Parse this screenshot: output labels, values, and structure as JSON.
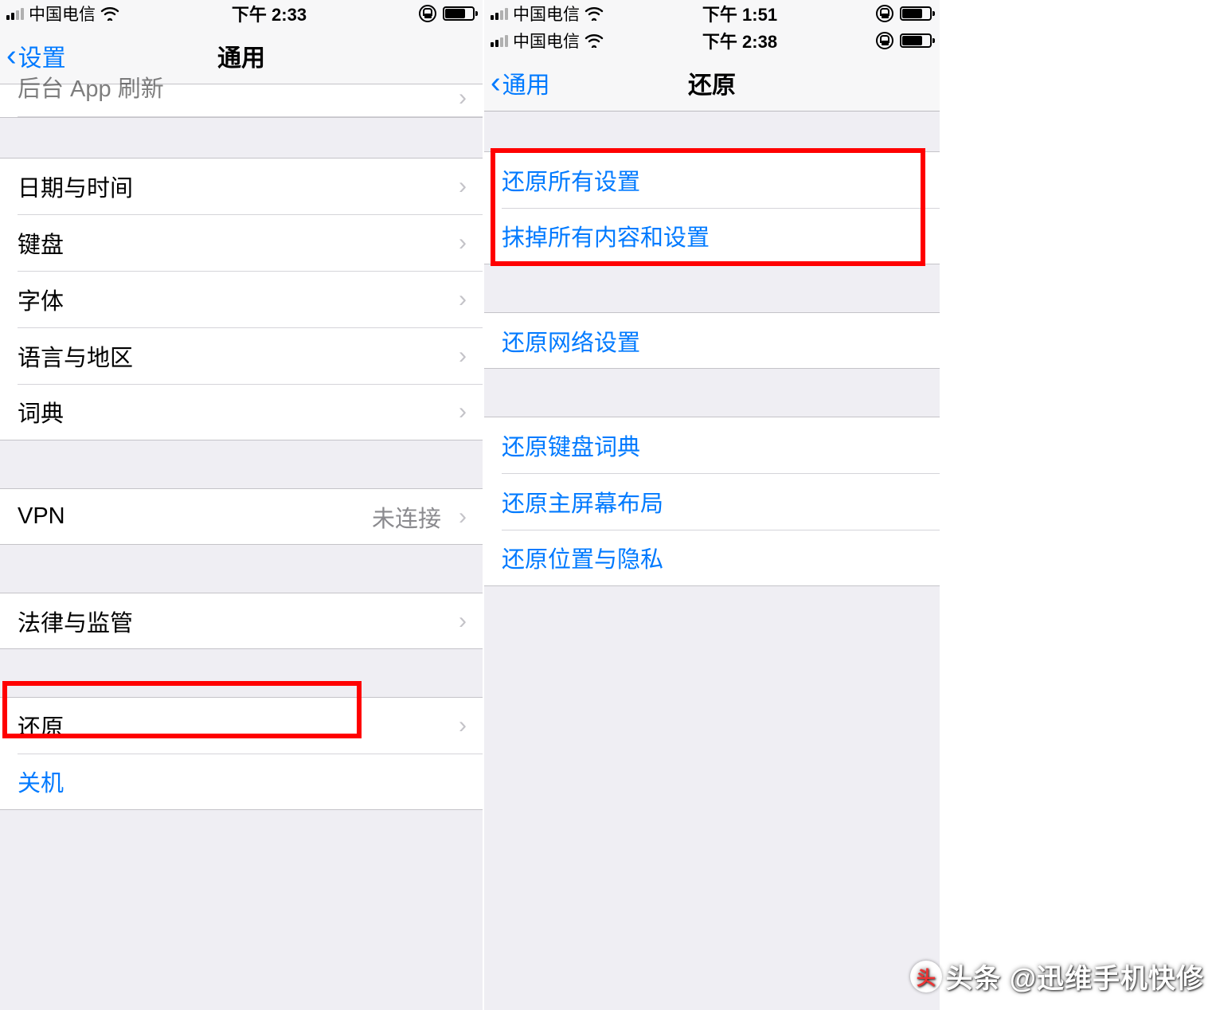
{
  "left": {
    "status": {
      "carrier": "中国电信",
      "time": "下午 2:33"
    },
    "nav": {
      "back": "设置",
      "title": "通用"
    },
    "partial_row": "后台 App 刷新",
    "group1": [
      "日期与时间",
      "键盘",
      "字体",
      "语言与地区",
      "词典"
    ],
    "vpn": {
      "label": "VPN",
      "value": "未连接"
    },
    "legal": "法律与监管",
    "reset": "还原",
    "shutdown": "关机"
  },
  "right": {
    "status_top": {
      "carrier": "中国电信",
      "time": "下午 1:51"
    },
    "status": {
      "carrier": "中国电信",
      "time": "下午 2:38"
    },
    "nav": {
      "back": "通用",
      "title": "还原"
    },
    "group1": [
      "还原所有设置",
      "抹掉所有内容和设置"
    ],
    "group2": [
      "还原网络设置"
    ],
    "group3": [
      "还原键盘词典",
      "还原主屏幕布局",
      "还原位置与隐私"
    ]
  },
  "watermark": "头条 @迅维手机快修"
}
